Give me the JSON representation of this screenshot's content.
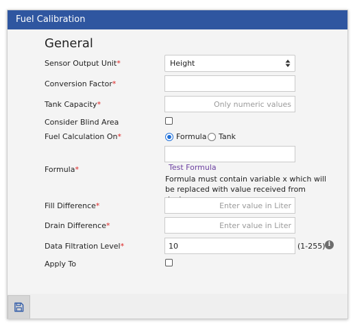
{
  "window": {
    "title": "Fuel Calibration"
  },
  "section": {
    "title": "General"
  },
  "fields": {
    "sensor_output_unit": {
      "label": "Sensor Output Unit",
      "selected": "Height"
    },
    "conversion_factor": {
      "label": "Conversion Factor",
      "value": ""
    },
    "tank_capacity": {
      "label": "Tank Capacity",
      "placeholder": "Only numeric values"
    },
    "consider_blind_area": {
      "label": "Consider Blind Area",
      "checked": false
    },
    "fuel_calculation_on": {
      "label": "Fuel Calculation On",
      "options": [
        "Formula",
        "Tank"
      ],
      "selected": "Formula"
    },
    "formula": {
      "label": "Formula",
      "value": "",
      "test_link": "Test Formula",
      "hint": "Formula must contain variable x which will be replaced with value received from device"
    },
    "fill_difference": {
      "label": "Fill Difference",
      "placeholder": "Enter value in Liter"
    },
    "drain_difference": {
      "label": "Drain Difference",
      "placeholder": "Enter value in Liter"
    },
    "data_filtration_level": {
      "label": "Data Filtration Level",
      "value": "10",
      "range": "(1-255)"
    },
    "apply_to": {
      "label": "Apply To",
      "checked": false
    }
  },
  "required_marker": "*",
  "icons": {
    "info": "info-icon",
    "save": "save-icon",
    "select_arrows": "sort-arrows-icon"
  },
  "colors": {
    "titlebar": "#2f56a0",
    "required": "#dd2222",
    "link": "#6b3fa0",
    "radio_accent": "#1e6fd9"
  }
}
